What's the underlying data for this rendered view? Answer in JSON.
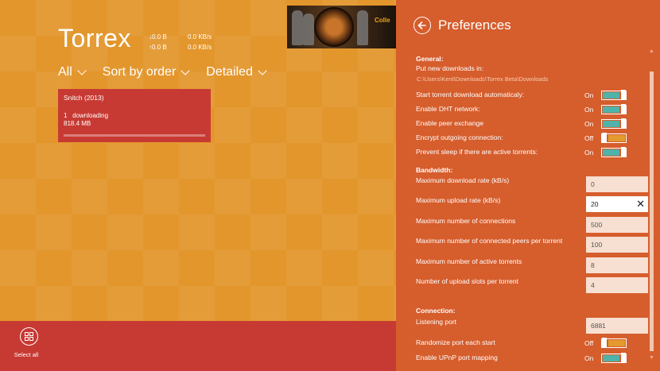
{
  "app": {
    "title": "Torrex",
    "stats": {
      "total_down": "↓0.0 B",
      "total_up": "↑0.0 B",
      "rate_down": "0.0 KB/s",
      "rate_up": "0.0 KB/s"
    },
    "ad_text": "Colle"
  },
  "filters": {
    "category": "All",
    "sort": "Sort by order",
    "view": "Detailed"
  },
  "torrents": [
    {
      "name": "Snitch (2013)",
      "index": "1",
      "status": "downloading",
      "size": "818.4 MB",
      "progress": 0
    }
  ],
  "appbar": {
    "select_all": "Select all"
  },
  "preferences": {
    "title": "Preferences",
    "general": {
      "header": "General:",
      "put_downloads_label": "Put new downloads in:",
      "download_path": "C:\\Users\\Kent\\Downloads\\Torrex Beta\\Downloads",
      "toggles": [
        {
          "label": "Start torrent download automaticaly:",
          "state": "On",
          "on": true
        },
        {
          "label": "Enable DHT network:",
          "state": "On",
          "on": true
        },
        {
          "label": "Enable peer exchange",
          "state": "On",
          "on": true
        },
        {
          "label": "Encrypt outgoing connection:",
          "state": "Off",
          "on": false
        },
        {
          "label": "Prevent sleep if there are active torrents:",
          "state": "On",
          "on": true
        }
      ]
    },
    "bandwidth": {
      "header": "Bandwidth:",
      "fields": [
        {
          "label": "Maximum download rate (kB/s)",
          "value": "0"
        },
        {
          "label": "Maximum upload rate (kB/s)",
          "value": "20",
          "focused": true
        },
        {
          "label": "Maximum number of connections",
          "value": "500"
        },
        {
          "label": "Maximum number of connected peers per torrent",
          "value": "100"
        },
        {
          "label": "Maximum number of active torrents",
          "value": "8"
        },
        {
          "label": "Number of upload slots per torrent",
          "value": "4"
        }
      ]
    },
    "connection": {
      "header": "Connection:",
      "port_label": "Listening port",
      "port_value": "6881",
      "toggles": [
        {
          "label": "Randomize port each start",
          "state": "Off",
          "on": false
        },
        {
          "label": "Enable UPnP port mapping",
          "state": "On",
          "on": true
        }
      ]
    }
  },
  "colors": {
    "app_bg": "#e3962c",
    "tile_bg": "#c73a33",
    "pane_bg": "#d65d2c",
    "toggle_on": "#4fb3a9",
    "toggle_off": "#e39a2e"
  }
}
